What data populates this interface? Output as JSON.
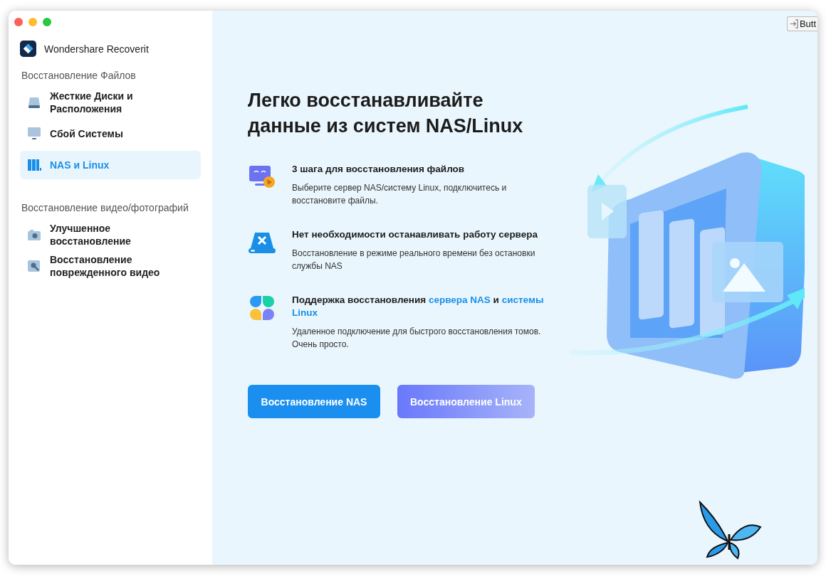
{
  "app": {
    "name": "Wondershare Recoverit"
  },
  "overlay_button": {
    "label": "Butt"
  },
  "sidebar": {
    "sections": [
      {
        "title": "Восстановление Файлов",
        "items": [
          {
            "label": "Жесткие Диски и Расположения",
            "kind": "drive",
            "selected": false
          },
          {
            "label": "Сбой Системы",
            "kind": "monitor",
            "selected": false
          },
          {
            "label": "NAS и Linux",
            "kind": "nas",
            "selected": true
          }
        ]
      },
      {
        "title": "Восстановление видео/фотографий",
        "items": [
          {
            "label": "Улучшенное восстановление",
            "kind": "camera",
            "selected": false
          },
          {
            "label": "Восстановление поврежденного видео",
            "kind": "repair",
            "selected": false
          }
        ]
      }
    ]
  },
  "main": {
    "title_lines": [
      "Легко восстанавливайте",
      "данные из систем NAS/Linux"
    ],
    "features": [
      {
        "kind": "steps",
        "title": [
          {
            "text": "3 шага для восстановления файлов",
            "highlight": false
          }
        ],
        "description": "Выберите сервер NAS/систему Linux, подключитесь и восстановите файлы."
      },
      {
        "kind": "server",
        "title": [
          {
            "text": "Нет необходимости останавливать работу сервера",
            "highlight": false
          }
        ],
        "description": "Восстановление в режиме реального времени без остановки службы NAS"
      },
      {
        "kind": "support",
        "title": [
          {
            "text": "Поддержка восстановления ",
            "highlight": false
          },
          {
            "text": "сервера NAS",
            "highlight": true
          },
          {
            "text": " и ",
            "highlight": false
          },
          {
            "text": "системы Linux",
            "highlight": true
          }
        ],
        "description": "Удаленное подключение для быстрого восстановления томов. Очень просто."
      }
    ],
    "buttons": [
      {
        "label": "Восстановление NAS",
        "kind": "primary"
      },
      {
        "label": "Восстановление Linux",
        "kind": "gradient"
      }
    ]
  }
}
